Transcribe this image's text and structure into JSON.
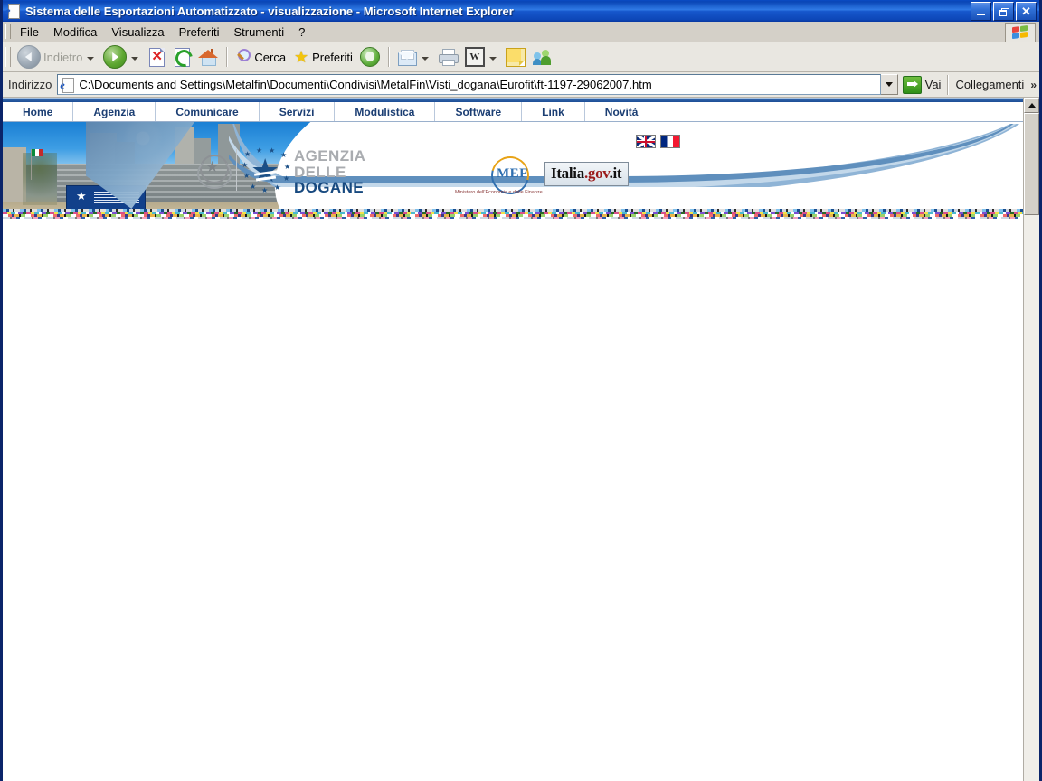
{
  "window": {
    "title": "Sistema delle Esportazioni Automatizzato - visualizzazione - Microsoft Internet Explorer",
    "icon": "ie-page-icon",
    "controls": {
      "minimize": "minimize-button",
      "restore": "restore-button",
      "close": "✕"
    }
  },
  "menubar": {
    "items": [
      {
        "label": "File"
      },
      {
        "label": "Modifica"
      },
      {
        "label": "Visualizza"
      },
      {
        "label": "Preferiti"
      },
      {
        "label": "Strumenti"
      },
      {
        "label": "?"
      }
    ],
    "brand_icon": "windows-flag-icon"
  },
  "toolbar": {
    "back_label": "Indietro",
    "back_enabled": false,
    "forward_label": "",
    "search_label": "Cerca",
    "favorites_label": "Preferiti",
    "icons": [
      "back-arrow-icon",
      "forward-arrow-icon",
      "stop-icon",
      "refresh-icon",
      "home-icon",
      "search-icon",
      "favorites-star-icon",
      "media-icon",
      "mail-icon",
      "print-icon",
      "edit-word-icon",
      "notes-icon",
      "messenger-icon"
    ]
  },
  "addressbar": {
    "label": "Indirizzo",
    "value": "C:\\Documents and Settings\\Metalfin\\Documenti\\Condivisi\\MetalFin\\Visti_dogana\\Eurofit\\ft-1197-29062007.htm",
    "placeholder": "Indirizzo",
    "go_label": "Vai",
    "links_label": "Collegamenti",
    "overflow_chevron": "»"
  },
  "page": {
    "nav": [
      {
        "label": "Home"
      },
      {
        "label": "Agenzia"
      },
      {
        "label": "Comunicare"
      },
      {
        "label": "Servizi"
      },
      {
        "label": "Modulistica"
      },
      {
        "label": "Software"
      },
      {
        "label": "Link"
      },
      {
        "label": "Novità"
      }
    ],
    "banner": {
      "photo_alt": "agenzia-dogane-building-photo",
      "emblem_alt": "repubblica-italiana-emblem",
      "logo": {
        "line1": "AGENZIA",
        "line2": "DELLE",
        "line3": "DOGANE"
      },
      "languages": [
        {
          "name": "english-flag",
          "title": "English"
        },
        {
          "name": "french-flag",
          "title": "Français"
        }
      ],
      "mef": {
        "acronym": "MEF",
        "subtitle": "Ministero dell'Economia e delle Finanze"
      },
      "italiagov": {
        "part1": "Italia",
        "part2": ".gov",
        "part3": ".it"
      }
    }
  },
  "colors": {
    "titlebar_blue": "#0a46b6",
    "chrome_gray": "#d4d0c8",
    "toolbar_gray": "#e9e7e1",
    "nav_text_blue": "#1b3e73",
    "dogane_blue": "#17497f",
    "logo_gray": "#a9acb0",
    "gov_red": "#9b1b1b"
  },
  "scrollbar": {
    "orientation": "vertical",
    "up_arrow": "scroll-up-arrow",
    "thumb": "scroll-thumb"
  }
}
